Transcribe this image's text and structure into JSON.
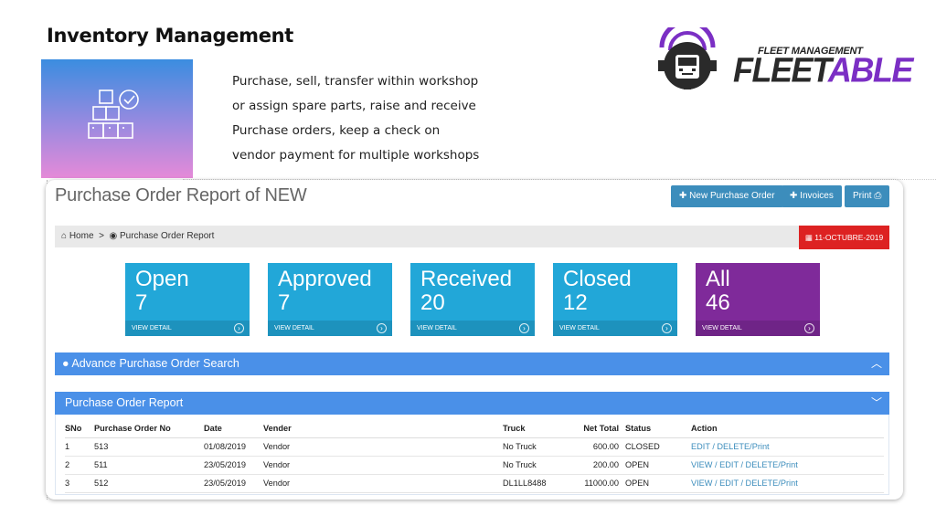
{
  "slide": {
    "title": "Inventory Management",
    "description_lines": [
      "Purchase, sell, transfer within workshop",
      "or assign spare parts, raise and receive",
      "Purchase orders, keep a check on",
      "vendor payment for multiple workshops"
    ]
  },
  "logo": {
    "sub": "FLEET MANAGEMENT",
    "word_a": "FLEET",
    "word_b": "ABLE"
  },
  "page": {
    "title": "Purchase Order Report of NEW",
    "buttons": {
      "new_po": "New Purchase Order",
      "invoices": "Invoices",
      "print": "Print"
    }
  },
  "breadcrumb": {
    "home": "Home",
    "current": "Purchase Order Report",
    "separator": ">"
  },
  "date_badge": "11-OCTUBRE-2019",
  "stats": [
    {
      "label": "Open",
      "count": "7",
      "link": "VIEW DETAIL",
      "color": "#22a7d8"
    },
    {
      "label": "Approved",
      "count": "7",
      "link": "VIEW DETAIL",
      "color": "#22a7d8"
    },
    {
      "label": "Received",
      "count": "20",
      "link": "VIEW DETAIL",
      "color": "#22a7d8"
    },
    {
      "label": "Closed",
      "count": "12",
      "link": "VIEW DETAIL",
      "color": "#22a7d8"
    },
    {
      "label": "All",
      "count": "46",
      "link": "VIEW DETAIL",
      "color": "#7f2a9a"
    }
  ],
  "panels": {
    "advance_search": "Advance Purchase Order Search",
    "report": "Purchase Order Report"
  },
  "table": {
    "headers": [
      "SNo",
      "Purchase Order No",
      "Date",
      "Vender",
      "Truck",
      "Net Total",
      "Status",
      "Action"
    ],
    "rows": [
      [
        "1",
        "513",
        "01/08/2019",
        "Vendor",
        "No Truck",
        "600.00",
        "CLOSED",
        "EDIT / DELETE/Print"
      ],
      [
        "2",
        "511",
        "23/05/2019",
        "Vendor",
        "No Truck",
        "200.00",
        "OPEN",
        "VIEW / EDIT / DELETE/Print"
      ],
      [
        "3",
        "512",
        "23/05/2019",
        "Vendor",
        "DL1LL8488",
        "11000.00",
        "OPEN",
        "VIEW / EDIT / DELETE/Print"
      ]
    ]
  },
  "colors": {
    "primary": "#3c8dbc",
    "panel": "#4a90e8",
    "danger": "#dd2222",
    "stat_blue": "#22a7d8",
    "stat_purple": "#7f2a9a"
  },
  "icons": [
    "boxes-check-icon",
    "gear-truck-logo-icon",
    "plus-icon",
    "print-icon",
    "home-icon",
    "dashboard-icon",
    "calendar-icon",
    "arrow-circle-right-icon",
    "chevron-up-icon",
    "chevron-down-icon",
    "info-circle-icon"
  ]
}
